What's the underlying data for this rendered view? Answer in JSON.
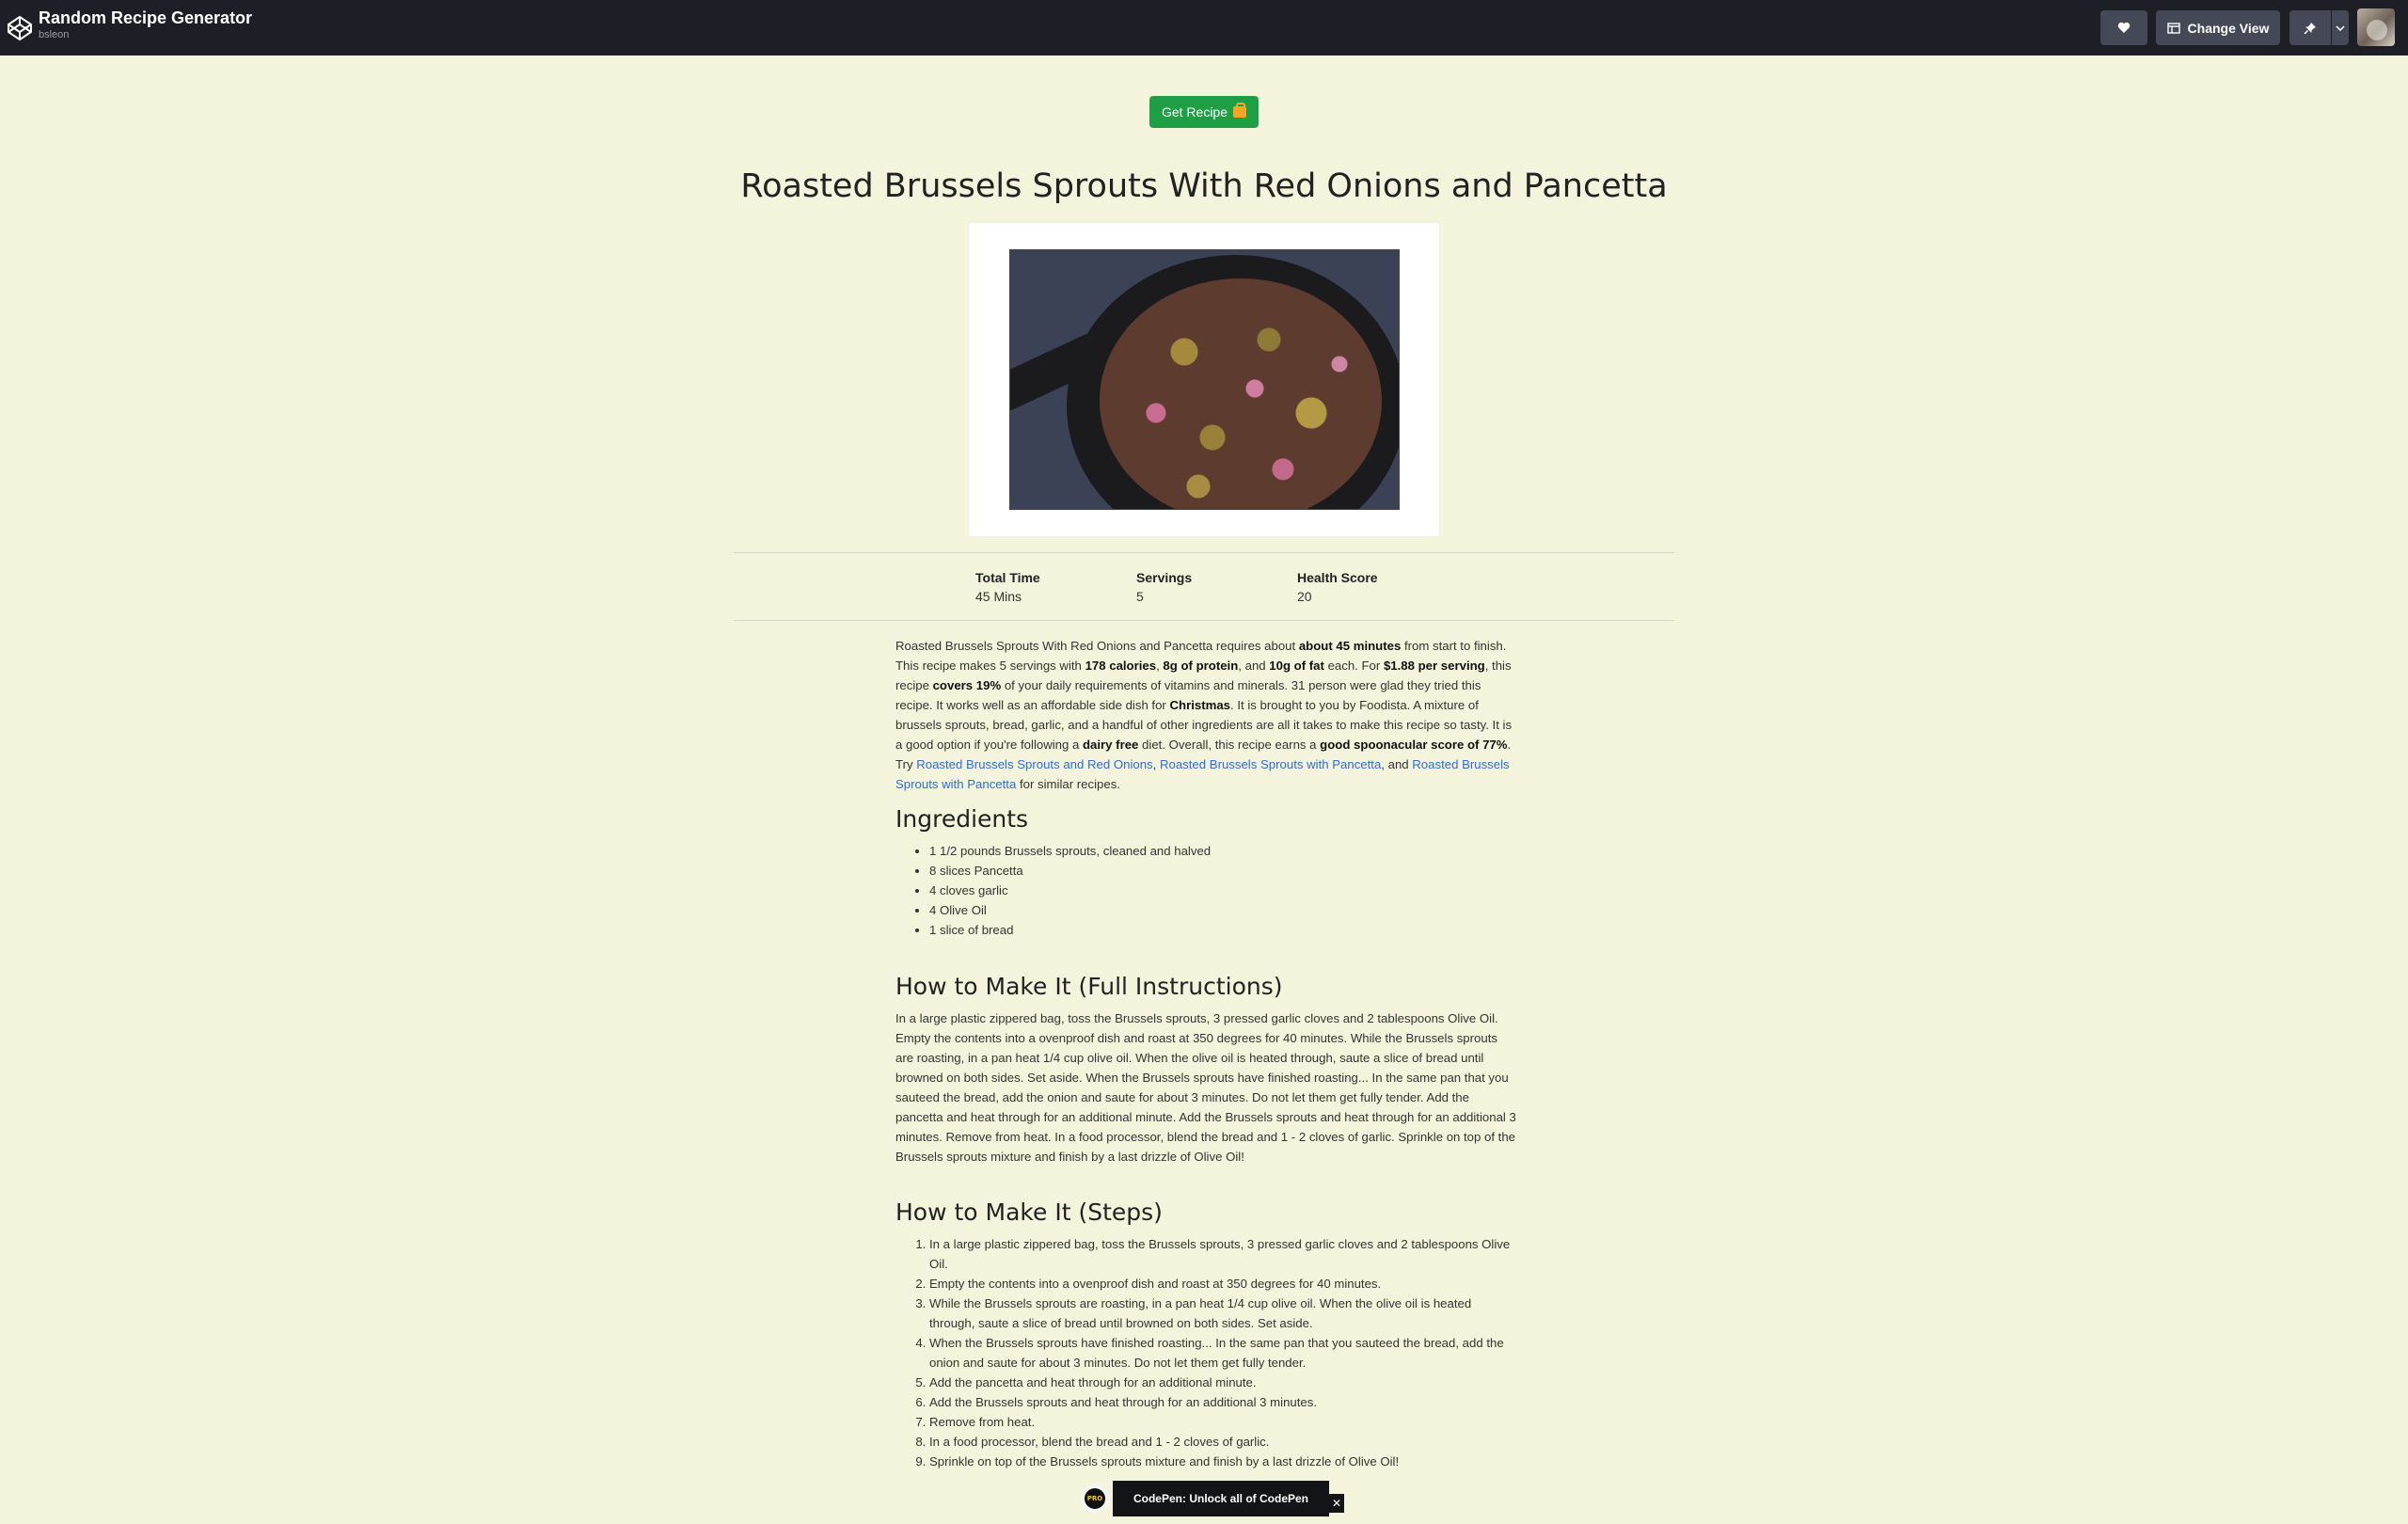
{
  "header": {
    "title": "Random Recipe Generator",
    "author": "bsleon",
    "change_view_label": "Change View"
  },
  "get_recipe_label": "Get Recipe",
  "recipe": {
    "title": "Roasted Brussels Sprouts With Red Onions and Pancetta",
    "stats": [
      {
        "label": "Total Time",
        "value": "45 Mins"
      },
      {
        "label": "Servings",
        "value": "5"
      },
      {
        "label": "Health Score",
        "value": "20"
      }
    ],
    "summary_parts": [
      {
        "t": "Roasted Brussels Sprouts With Red Onions and Pancetta requires about "
      },
      {
        "t": "about 45 minutes",
        "b": true
      },
      {
        "t": " from start to finish. This recipe makes 5 servings with "
      },
      {
        "t": "178 calories",
        "b": true
      },
      {
        "t": ", "
      },
      {
        "t": "8g of protein",
        "b": true
      },
      {
        "t": ", and "
      },
      {
        "t": "10g of fat",
        "b": true
      },
      {
        "t": " each. For "
      },
      {
        "t": "$1.88 per serving",
        "b": true
      },
      {
        "t": ", this recipe "
      },
      {
        "t": "covers 19%",
        "b": true
      },
      {
        "t": " of your daily requirements of vitamins and minerals. 31 person were glad they tried this recipe. It works well as an affordable side dish for "
      },
      {
        "t": "Christmas",
        "b": true
      },
      {
        "t": ". It is brought to you by Foodista. A mixture of brussels sprouts, bread, garlic, and a handful of other ingredients are all it takes to make this recipe so tasty. It is a good option if you're following a "
      },
      {
        "t": "dairy free",
        "b": true
      },
      {
        "t": " diet. Overall, this recipe earns a "
      },
      {
        "t": "good spoonacular score of 77%",
        "b": true
      },
      {
        "t": ". Try "
      },
      {
        "t": "Roasted Brussels Sprouts and Red Onions",
        "a": true
      },
      {
        "t": ", "
      },
      {
        "t": "Roasted Brussels Sprouts with Pancetta",
        "a": true
      },
      {
        "t": ", and "
      },
      {
        "t": "Roasted Brussels Sprouts with Pancetta",
        "a": true
      },
      {
        "t": " for similar recipes."
      }
    ],
    "ingredients_heading": "Ingredients",
    "ingredients": [
      "1 1/2 pounds Brussels sprouts, cleaned and halved",
      "8 slices Pancetta",
      "4 cloves garlic",
      "4 Olive Oil",
      "1 slice of bread"
    ],
    "full_heading": "How to Make It (Full Instructions)",
    "full_instructions": "In a large plastic zippered bag, toss the Brussels sprouts, 3 pressed garlic cloves and 2 tablespoons Olive Oil. Empty the contents into a ovenproof dish and roast at 350 degrees for 40 minutes. While the Brussels sprouts are roasting, in a pan heat 1/4 cup olive oil. When the olive oil is heated through, saute a slice of bread until browned on both sides. Set aside. When the Brussels sprouts have finished roasting... In the same pan that you sauteed the bread, add the onion and saute for about 3 minutes. Do not let them get fully tender. Add the pancetta and heat through for an additional minute. Add the Brussels sprouts and heat through for an additional 3 minutes. Remove from heat. In a food processor, blend the bread and 1 - 2 cloves of garlic. Sprinkle on top of the Brussels sprouts mixture and finish by a last drizzle of Olive Oil!",
    "steps_heading": "How to Make It (Steps)",
    "steps": [
      "In a large plastic zippered bag, toss the Brussels sprouts, 3 pressed garlic cloves and 2 tablespoons Olive Oil.",
      "Empty the contents into a ovenproof dish and roast at 350 degrees for 40 minutes.",
      "While the Brussels sprouts are roasting, in a pan heat 1/4 cup olive oil. When the olive oil is heated through, saute a slice of bread until browned on both sides. Set aside.",
      "When the Brussels sprouts have finished roasting... In the same pan that you sauteed the bread, add the onion and saute for about 3 minutes. Do not let them get fully tender.",
      "Add the pancetta and heat through for an additional minute.",
      "Add the Brussels sprouts and heat through for an additional 3 minutes.",
      "Remove from heat.",
      "In a food processor, blend the bread and 1 - 2 cloves of garlic.",
      "Sprinkle on top of the Brussels sprouts mixture and finish by a last drizzle of Olive Oil!"
    ]
  },
  "codepen_banner": {
    "badge": "PRO",
    "text": "CodePen: Unlock all of CodePen",
    "close": "✕"
  },
  "colors": {
    "background": "#f4f4dc",
    "topbar": "#1e1f26",
    "button_green": "#1e9e45",
    "link": "#2a6ed8"
  }
}
